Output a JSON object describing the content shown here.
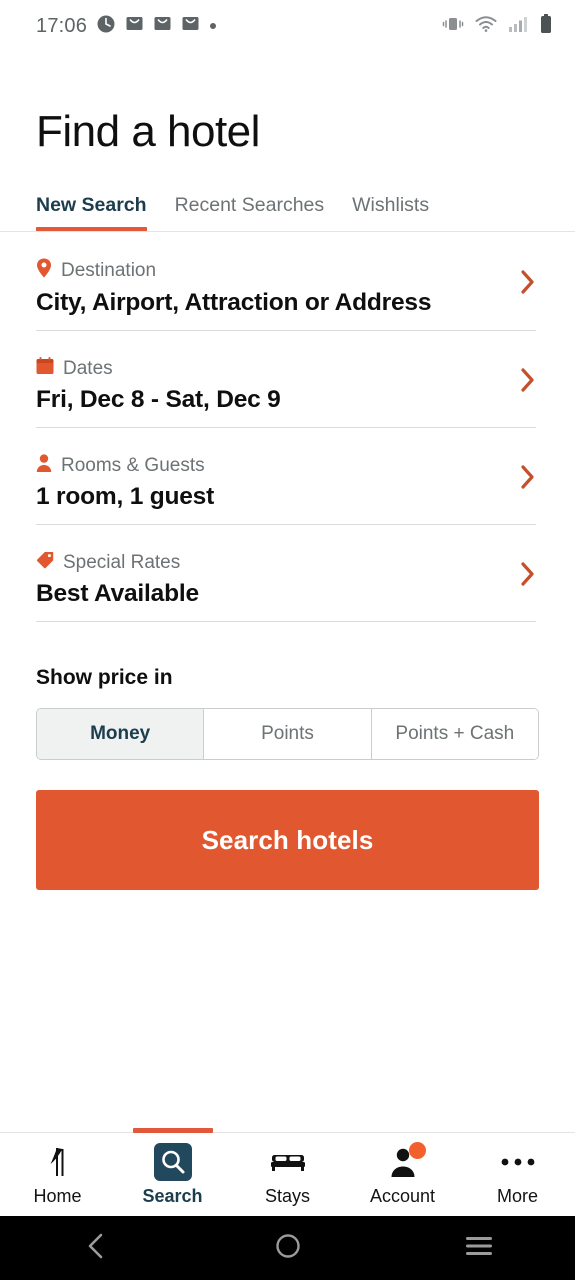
{
  "status_bar": {
    "time": "17:06",
    "left_icons": [
      "clock-alarm-icon",
      "mail-icon",
      "mail-icon",
      "mail-icon",
      "dot-icon"
    ],
    "right_icons": [
      "vibrate-icon",
      "wifi-icon",
      "cellular-signal-icon",
      "battery-icon"
    ]
  },
  "header": {
    "title": "Find a hotel"
  },
  "tabs": [
    {
      "label": "New Search",
      "active": true
    },
    {
      "label": "Recent Searches",
      "active": false
    },
    {
      "label": "Wishlists",
      "active": false
    }
  ],
  "search_form": {
    "rows": [
      {
        "icon": "location-pin-icon",
        "label": "Destination",
        "value": "City, Airport, Attraction or Address"
      },
      {
        "icon": "calendar-icon",
        "label": "Dates",
        "value": "Fri, Dec 8 - Sat, Dec 9"
      },
      {
        "icon": "person-icon",
        "label": "Rooms & Guests",
        "value": "1 room, 1 guest"
      },
      {
        "icon": "price-tag-icon",
        "label": "Special Rates",
        "value": "Best Available"
      }
    ]
  },
  "price_display": {
    "heading": "Show price in",
    "options": [
      {
        "label": "Money",
        "selected": true
      },
      {
        "label": "Points",
        "selected": false
      },
      {
        "label": "Points + Cash",
        "selected": false
      }
    ]
  },
  "cta": {
    "label": "Search hotels"
  },
  "bottom_nav": [
    {
      "label": "Home",
      "icon": "marriott-logo-icon",
      "active": false,
      "badge": false
    },
    {
      "label": "Search",
      "icon": "magnifier-icon",
      "active": true,
      "badge": false
    },
    {
      "label": "Stays",
      "icon": "bed-icon",
      "active": false,
      "badge": false
    },
    {
      "label": "Account",
      "icon": "person-icon",
      "active": false,
      "badge": true
    },
    {
      "label": "More",
      "icon": "ellipsis-icon",
      "active": false,
      "badge": false
    }
  ],
  "android_nav": {
    "back": "back-chevron-icon",
    "home": "home-circle-icon",
    "recents": "recents-menu-icon"
  },
  "colors": {
    "accent_orange": "#e1572f",
    "tab_indicator": "#e1593a",
    "active_teal": "#1c3d4d",
    "text_primary": "#0f0f0f",
    "text_secondary": "#6d7275",
    "divider": "#dcdcdc",
    "segment_selected_bg": "#f0f2f2"
  }
}
